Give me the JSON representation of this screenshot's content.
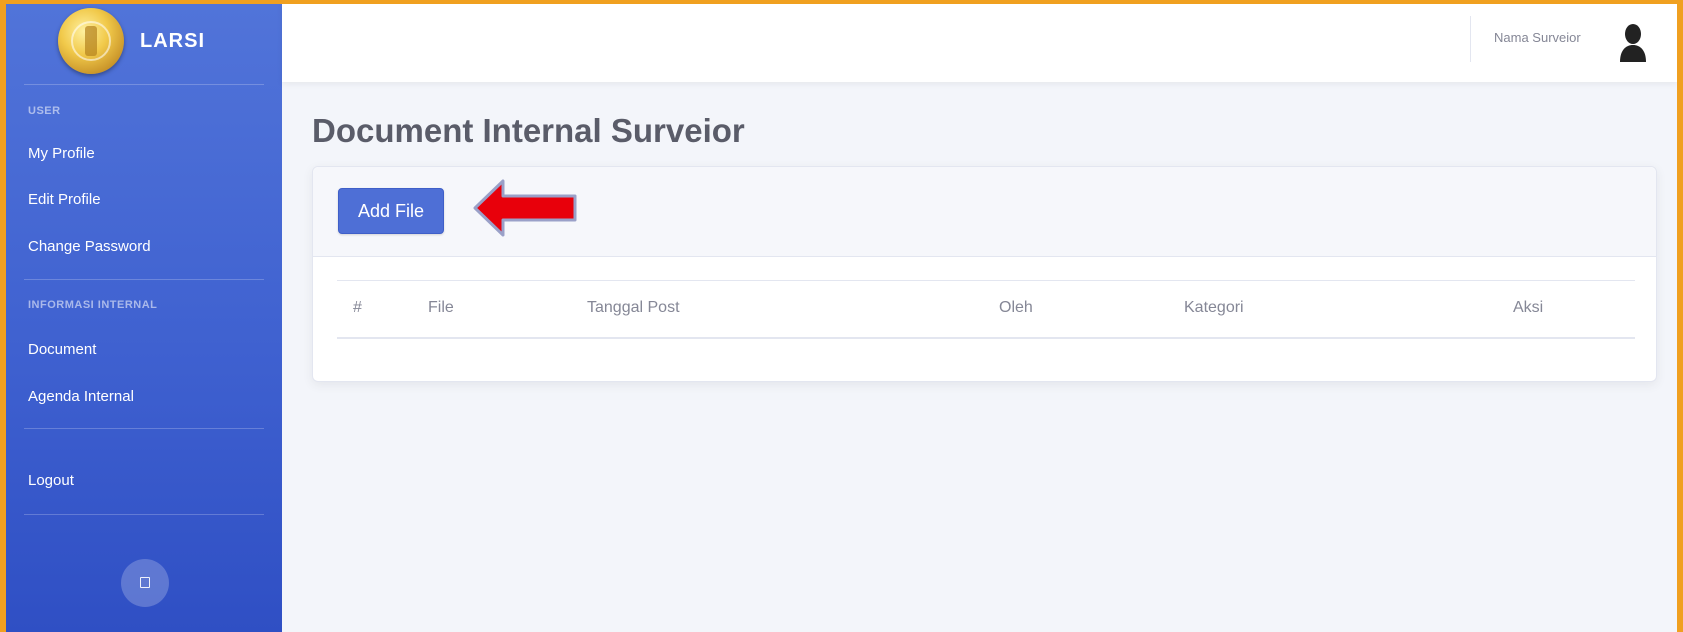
{
  "app": {
    "brand": "LARSI",
    "logo_icon": "larsi-logo-icon"
  },
  "sidebar": {
    "sections": [
      {
        "heading": "USER",
        "items": [
          "My Profile",
          "Edit Profile",
          "Change Password"
        ]
      },
      {
        "heading": "INFORMASI INTERNAL",
        "items": [
          "Document",
          "Agenda Internal"
        ]
      }
    ],
    "logout": "Logout",
    "toggle_icon": "sidebar-toggle-icon"
  },
  "topbar": {
    "user_name": "Nama Surveior",
    "avatar_icon": "user-silhouette-icon"
  },
  "main": {
    "title": "Document Internal Surveior",
    "add_button": "Add File",
    "annotation_icon": "red-arrow-icon",
    "table": {
      "columns": [
        "#",
        "File",
        "Tanggal Post",
        "Oleh",
        "Kategori",
        "Aksi"
      ],
      "rows": []
    }
  },
  "colors": {
    "sidebar": "#4565d2",
    "primary": "#4e6fd6",
    "page_bg": "#f3f5fa",
    "border": "#f0a020",
    "arrow": "#e8000b"
  }
}
